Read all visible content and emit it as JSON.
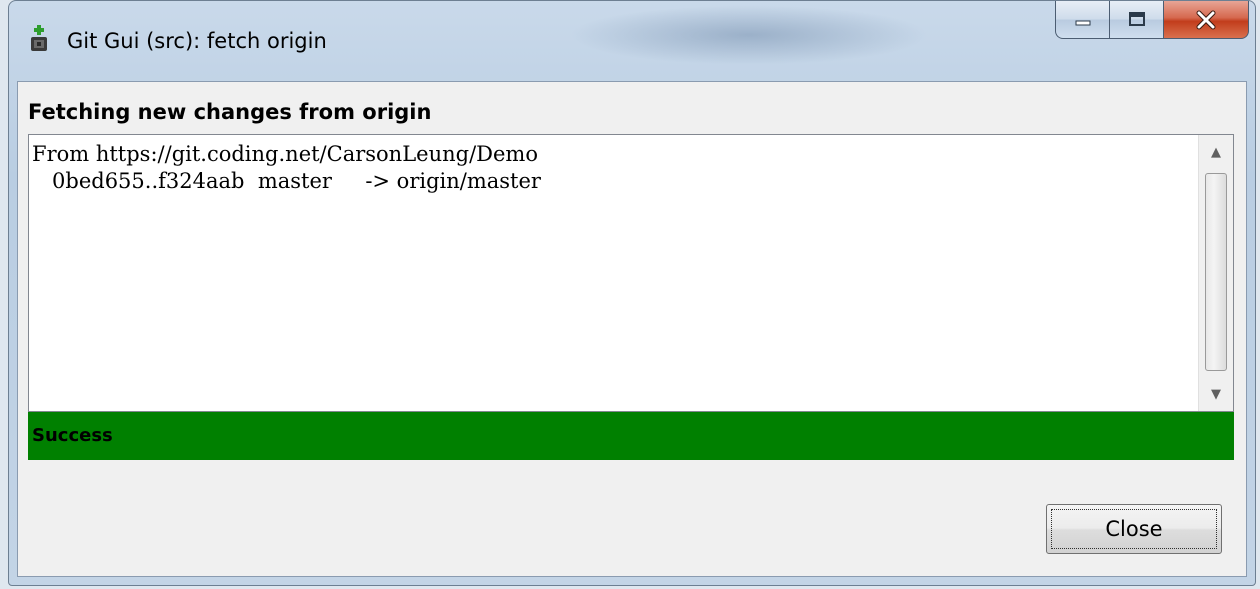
{
  "window": {
    "title": "Git Gui (src): fetch origin",
    "caption_buttons": {
      "minimize": "minimize-icon",
      "maximize": "maximize-icon",
      "close": "close-icon"
    }
  },
  "dialog": {
    "heading": "Fetching new changes from origin",
    "output_lines": [
      "From https://git.coding.net/CarsonLeung/Demo",
      "   0bed655..f324aab  master     -> origin/master"
    ],
    "status": "Success",
    "close_label": "Close"
  },
  "colors": {
    "status_background": "#008000",
    "close_caption_button": "#c23d1c"
  }
}
